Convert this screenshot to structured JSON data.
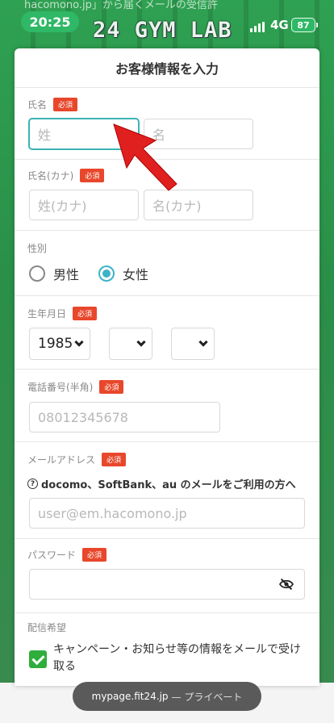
{
  "status_bar": {
    "time": "20:25",
    "network": "4G",
    "battery": "87"
  },
  "bg_text": "hacomono.jp」から届くメールの受信許",
  "logo": "24 GYM LAB",
  "modal": {
    "title": "お客様情報を入力"
  },
  "required_badge": "必須",
  "name": {
    "label": "氏名",
    "last_placeholder": "姓",
    "first_placeholder": "名"
  },
  "name_kana": {
    "label": "氏名(カナ)",
    "last_placeholder": "姓(カナ)",
    "first_placeholder": "名(カナ)"
  },
  "gender": {
    "label": "性別",
    "options": [
      "男性",
      "女性"
    ],
    "selected": "女性"
  },
  "birthday": {
    "label": "生年月日",
    "year": "1985",
    "month": "",
    "day": ""
  },
  "phone": {
    "label": "電話番号(半角)",
    "placeholder": "08012345678"
  },
  "email": {
    "label": "メールアドレス",
    "notice": "docomo、SoftBank、au のメールをご利用の方へ",
    "notice_icon": "question-circle-icon",
    "placeholder": "user@em.hacomono.jp"
  },
  "password": {
    "label": "パスワード",
    "placeholder": "",
    "toggle_icon": "eye-off-icon"
  },
  "newsletter": {
    "label": "配信希望",
    "checkbox_label": "キャンペーン・お知らせ等の情報をメールで受け取る",
    "checked": true
  },
  "browser": {
    "url": "mypage.fit24.jp",
    "mode": "— プライベート"
  },
  "colors": {
    "accent": "#3bb3c9",
    "required": "#e8472b",
    "check": "#2fae3c",
    "background": "#2a8f48"
  }
}
